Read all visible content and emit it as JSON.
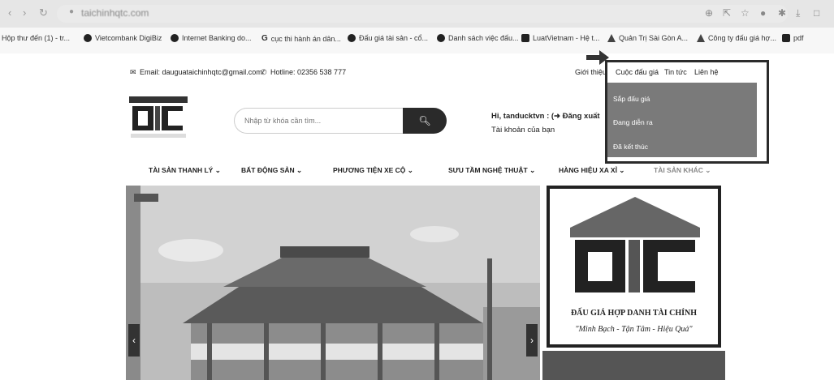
{
  "browser": {
    "url": "taichinhqtc.com",
    "bookmarks": [
      {
        "label": "Hộp thư đến (1) - tr...",
        "icon": "none"
      },
      {
        "label": "Vietcombank DigiBiz",
        "icon": "map-pin-icon"
      },
      {
        "label": "Internet Banking do...",
        "icon": "bank-icon"
      },
      {
        "label": "cục thi hành án dân...",
        "icon": "google-icon"
      },
      {
        "label": "Đấu giá tài sản - cổ...",
        "icon": "globe-icon"
      },
      {
        "label": "Danh sách việc đấu...",
        "icon": "drop-icon"
      },
      {
        "label": "LuatVietnam - Hệ t...",
        "icon": "book-icon"
      },
      {
        "label": "Quản Trị Sài Gòn A...",
        "icon": "drive-icon"
      },
      {
        "label": "Công ty đấu giá hợ...",
        "icon": "drive-icon"
      },
      {
        "label": "pdf",
        "icon": "folder-icon"
      }
    ]
  },
  "header": {
    "email": "Email: dauguataichinhqtc@gmail.com",
    "hotline": "Hotline: 02356 538 777",
    "about": "Giới thiệu",
    "greeting": "Hi, tanducktvn : (➜ Đăng xuất",
    "account": "Tài khoản của bạn"
  },
  "search": {
    "placeholder": "Nhập từ khóa cần tìm...",
    "button_icon": "search-icon"
  },
  "nav": {
    "categories": [
      "TÀI SẢN THANH LÝ ⌄",
      "BẤT ĐỘNG SẢN ⌄",
      "PHƯƠNG TIỆN XE CỘ ⌄",
      "SƯU TẦM NGHỆ THUẬT ⌄",
      "HÀNG HIỆU XA XỈ ⌄",
      "TÀI SẢN KHÁC ⌄"
    ]
  },
  "dropdown": {
    "top_links": [
      "Cuộc đấu giá",
      "Tin tức",
      "Liên hệ"
    ],
    "items": [
      "Sắp đấu giá",
      "Đang diễn ra",
      "Đã kết thúc"
    ]
  },
  "logo": {
    "text": "QTC"
  },
  "banner": {
    "logo_text": "QTC",
    "title": "ĐẤU GIÁ HỢP DANH TÀI CHÍNH",
    "slogan": "\"Minh Bạch - Tận Tâm - Hiệu Quả\""
  },
  "slider": {
    "prev": "‹",
    "next": "›"
  },
  "colors": {
    "dark": "#2a2a2a",
    "dropdown_bg": "#7a7a7a"
  }
}
